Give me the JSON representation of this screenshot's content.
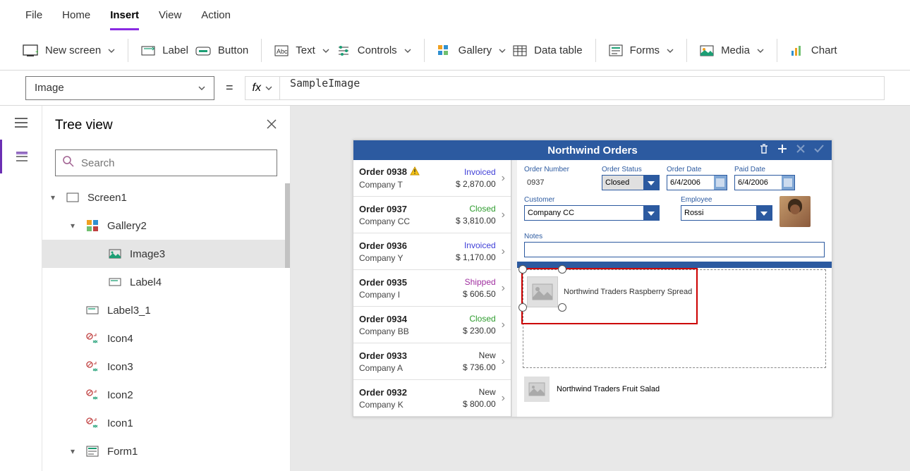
{
  "menu": {
    "file": "File",
    "home": "Home",
    "insert": "Insert",
    "view": "View",
    "action": "Action"
  },
  "ribbon": {
    "newScreen": "New screen",
    "label": "Label",
    "button": "Button",
    "text": "Text",
    "controls": "Controls",
    "gallery": "Gallery",
    "dataTable": "Data table",
    "forms": "Forms",
    "media": "Media",
    "chart": "Chart"
  },
  "propertySelector": "Image",
  "formula": "SampleImage",
  "treeview": {
    "title": "Tree view",
    "searchPlaceholder": "Search",
    "nodes": {
      "screen1": "Screen1",
      "gallery2": "Gallery2",
      "image3": "Image3",
      "label4": "Label4",
      "label3_1": "Label3_1",
      "icon4": "Icon4",
      "icon3": "Icon3",
      "icon2": "Icon2",
      "icon1": "Icon1",
      "form1": "Form1"
    }
  },
  "app": {
    "title": "Northwind Orders",
    "orders": [
      {
        "num": "Order 0938",
        "warn": true,
        "co": "Company T",
        "status": "Invoiced",
        "statusClass": "invoiced",
        "amount": "$ 2,870.00"
      },
      {
        "num": "Order 0937",
        "warn": false,
        "co": "Company CC",
        "status": "Closed",
        "statusClass": "closed",
        "amount": "$ 3,810.00"
      },
      {
        "num": "Order 0936",
        "warn": false,
        "co": "Company Y",
        "status": "Invoiced",
        "statusClass": "invoiced",
        "amount": "$ 1,170.00"
      },
      {
        "num": "Order 0935",
        "warn": false,
        "co": "Company I",
        "status": "Shipped",
        "statusClass": "shipped",
        "amount": "$ 606.50"
      },
      {
        "num": "Order 0934",
        "warn": false,
        "co": "Company BB",
        "status": "Closed",
        "statusClass": "closed",
        "amount": "$ 230.00"
      },
      {
        "num": "Order 0933",
        "warn": false,
        "co": "Company A",
        "status": "New",
        "statusClass": "new",
        "amount": "$ 736.00"
      },
      {
        "num": "Order 0932",
        "warn": false,
        "co": "Company K",
        "status": "New",
        "statusClass": "new",
        "amount": "$ 800.00"
      }
    ],
    "detail": {
      "orderNumberLabel": "Order Number",
      "orderNumberValue": "0937",
      "orderStatusLabel": "Order Status",
      "orderStatusValue": "Closed",
      "orderDateLabel": "Order Date",
      "orderDateValue": "6/4/2006",
      "paidDateLabel": "Paid Date",
      "paidDateValue": "6/4/2006",
      "customerLabel": "Customer",
      "customerValue": "Company CC",
      "employeeLabel": "Employee",
      "employeeValue": "Rossi",
      "notesLabel": "Notes"
    },
    "products": {
      "p1": "Northwind Traders Raspberry Spread",
      "p2": "Northwind Traders Fruit Salad"
    }
  }
}
